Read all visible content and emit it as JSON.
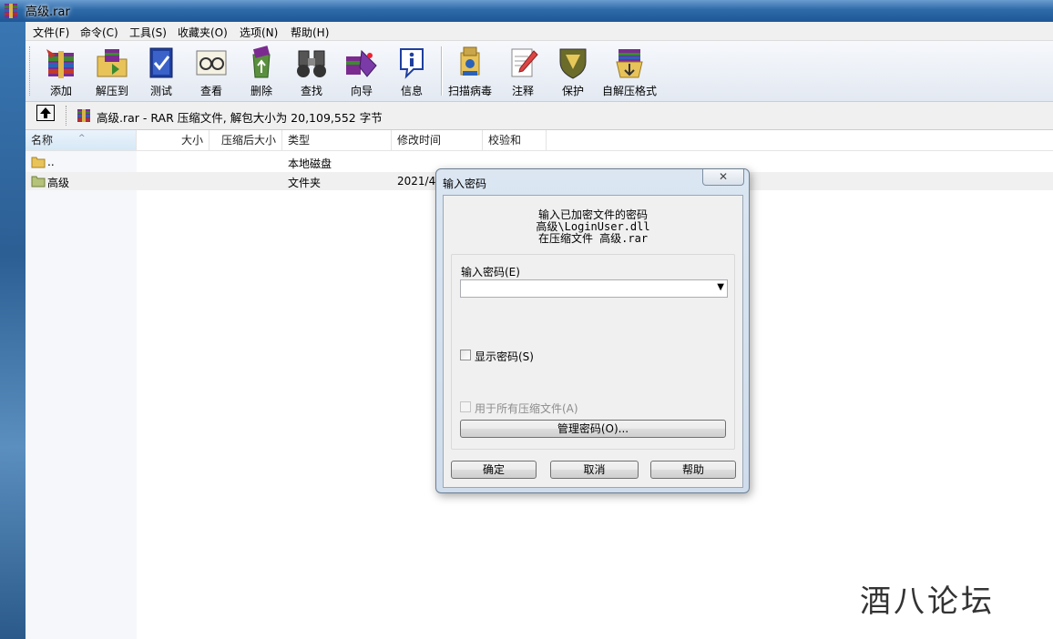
{
  "window": {
    "title": "高级.rar"
  },
  "menu": [
    "文件(F)",
    "命令(C)",
    "工具(S)",
    "收藏夹(O)",
    "选项(N)",
    "帮助(H)"
  ],
  "toolbar": {
    "add": "添加",
    "extract": "解压到",
    "test": "测试",
    "view": "查看",
    "delete": "删除",
    "find": "查找",
    "wizard": "向导",
    "info": "信息",
    "scan": "扫描病毒",
    "comment": "注释",
    "protect": "保护",
    "sfx": "自解压格式"
  },
  "address": {
    "text": "高级.rar - RAR 压缩文件, 解包大小为 20,109,552 字节"
  },
  "columns": {
    "name": "名称",
    "size": "大小",
    "packed": "压缩后大小",
    "type": "类型",
    "modified": "修改时间",
    "crc": "校验和"
  },
  "files": [
    {
      "name": "..",
      "type": "本地磁盘",
      "modified": ""
    },
    {
      "name": "高级",
      "type": "文件夹",
      "modified": "2021/4"
    }
  ],
  "dialog": {
    "title": "输入密码",
    "close": "✕",
    "msg1": "输入已加密文件的密码",
    "msg2": "高级\\LoginUser.dll",
    "msg3": "在压缩文件 高级.rar",
    "password_label": "输入密码(E)",
    "password_value": "",
    "show_password": "显示密码(S)",
    "use_for_all": "用于所有压缩文件(A)",
    "manage": "管理密码(O)...",
    "ok": "确定",
    "cancel": "取消",
    "help": "帮助"
  },
  "watermark": "酒八论坛"
}
